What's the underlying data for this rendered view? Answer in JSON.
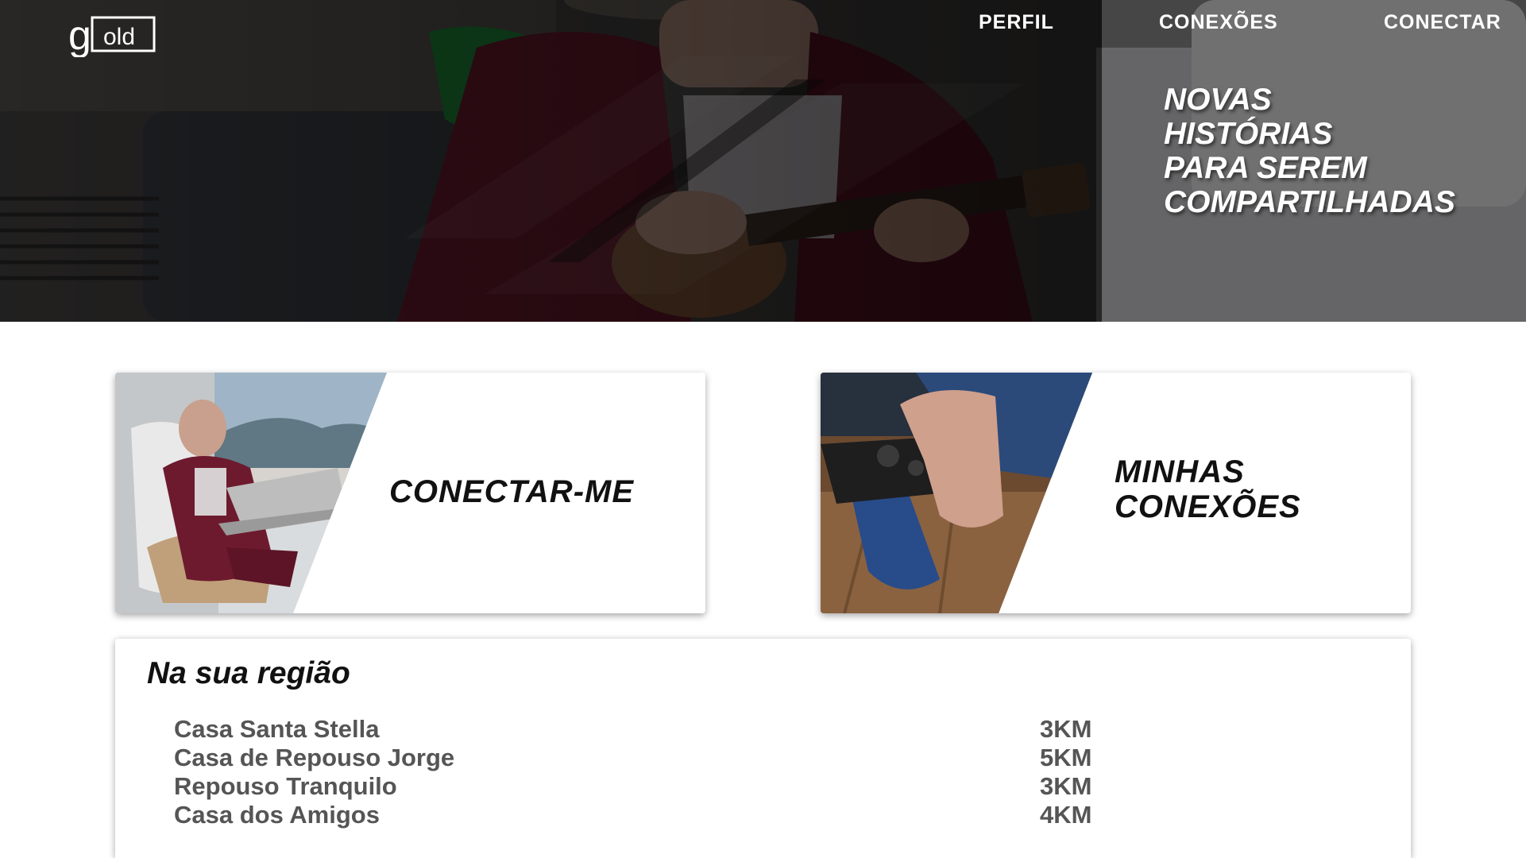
{
  "nav": {
    "perfil": "PERFIL",
    "conexoes": "CONEXÕES",
    "conectar": "CONECTAR"
  },
  "hero": {
    "headline_lines": [
      "NOVAS",
      "HISTÓRIAS",
      "PARA SEREM",
      "COMPARTILHADAS"
    ]
  },
  "cards": {
    "connect_label": "CONECTAR-ME",
    "my_connections_label": "MINHAS CONEXÕES"
  },
  "region": {
    "title": "Na sua região",
    "places": [
      {
        "name": "Casa Santa Stella",
        "distance": "3KM"
      },
      {
        "name": "Casa de Repouso Jorge",
        "distance": "5KM"
      },
      {
        "name": "Repouso Tranquilo",
        "distance": "3KM"
      },
      {
        "name": "Casa dos Amigos",
        "distance": "4KM"
      }
    ]
  },
  "icons": {
    "logo": "gold-logo"
  },
  "colors": {
    "robe": "#6e1a2e",
    "text_dark": "#111111",
    "text_muted": "#555555"
  }
}
